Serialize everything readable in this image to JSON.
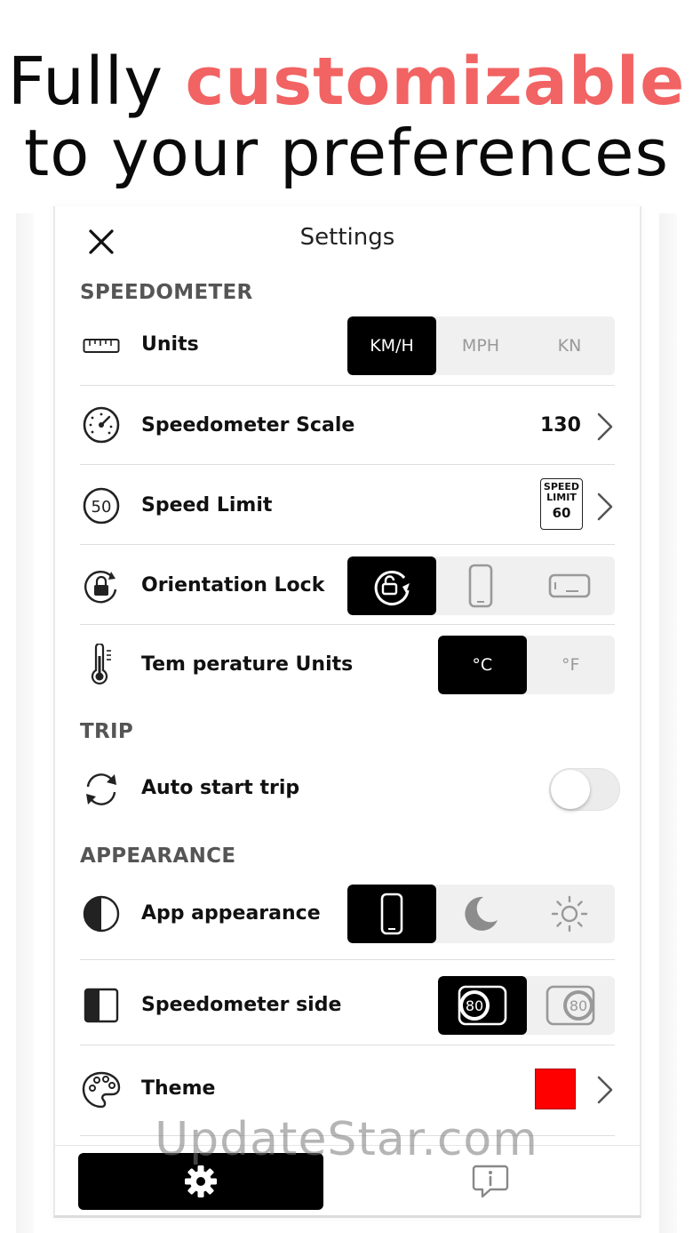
{
  "headline": {
    "line1_plain": "Fully",
    "line1_accent": "customizable",
    "line2": "to your preferences",
    "accent_color": "#f26363"
  },
  "header": {
    "title": "Settings",
    "close_icon": "close-icon"
  },
  "sections": {
    "speedometer": "SPEEDOMETER",
    "trip": "TRIP",
    "appearance": "APPEARANCE"
  },
  "rows": {
    "units": {
      "label": "Units",
      "icon": "ruler-icon",
      "options": [
        "KM/H",
        "MPH",
        "KN"
      ],
      "selected": "KM/H"
    },
    "scale": {
      "label": "Speedometer Scale",
      "icon": "gauge-icon",
      "value": "130"
    },
    "speed_limit": {
      "label": "Speed Limit",
      "icon": "speed-50-icon",
      "icon_text": "50",
      "sign_line1": "SPEED",
      "sign_line2": "LIMIT",
      "sign_value": "60"
    },
    "orientation": {
      "label": "Orientation Lock",
      "icon": "rotation-lock-icon",
      "options": [
        "auto-rotate-icon",
        "portrait-phone-icon",
        "landscape-phone-icon"
      ],
      "selected": "auto-rotate-icon"
    },
    "temperature": {
      "label": "Tem perature Units",
      "icon": "thermometer-icon",
      "options": [
        "°C",
        "°F"
      ],
      "selected": "°C"
    },
    "auto_start": {
      "label": "Auto start trip",
      "icon": "sync-icon",
      "enabled": false
    },
    "app_appearance": {
      "label": "App appearance",
      "icon": "half-circle-icon",
      "options": [
        "phone-icon",
        "moon-icon",
        "sun-icon"
      ],
      "selected": "phone-icon"
    },
    "speedometer_side": {
      "label": "Speedometer side",
      "icon": "side-panel-icon",
      "options": [
        "80",
        "80"
      ],
      "selected_index": 0
    },
    "theme": {
      "label": "Theme",
      "icon": "palette-icon",
      "color": "#ff0000"
    }
  },
  "tabbar": {
    "active": "settings-gear-icon",
    "other": "info-bubble-icon"
  },
  "watermark": "UpdateStar.com"
}
